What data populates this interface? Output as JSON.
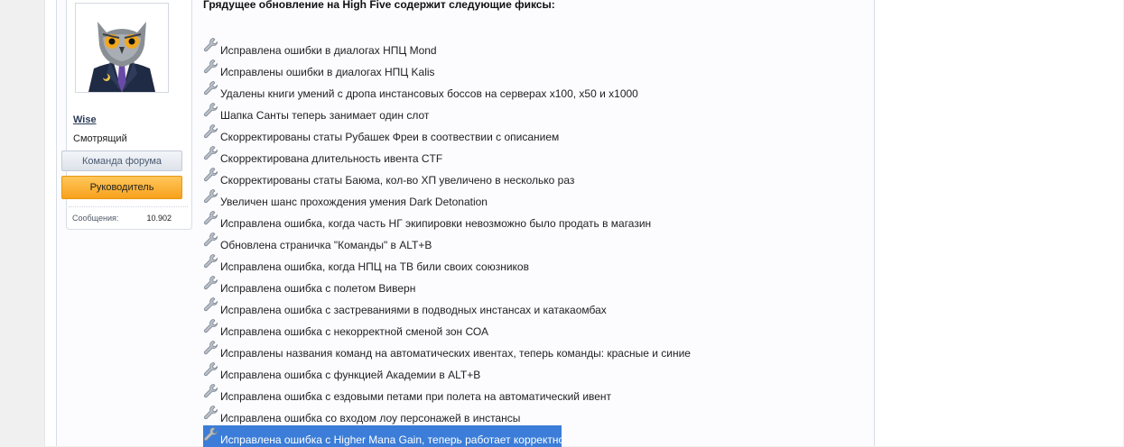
{
  "user": {
    "name": "Wise",
    "title": "Смотрящий",
    "badge_team": "Команда форума",
    "badge_role": "Руководитель",
    "messages_label": "Сообщения:",
    "messages_count": "10.902"
  },
  "post": {
    "heading": "Грядущее обновление на High Five содержит следующие фиксы:",
    "fixes": [
      "Исправлена ошибки в диалогах НПЦ Mond",
      "Исправлены ошибки в диалогах НПЦ Kalis",
      "Удалены книги умений с дропа инстансовых боссов на серверах x100, x50 и x1000",
      "Шапка Санты теперь занимает один слот",
      "Скорректированы статы Рубашек Фреи в соотвествии с описанием",
      "Скорректирована длительность ивента CTF",
      "Скорректированы статы Баюма, кол-во ХП увеличено в несколько раз",
      "Увеличен шанс прохождения умения Dark Detonation",
      "Исправлена ошибка, когда часть НГ экипировки невозможно было продать в магазин",
      "Обновлена страничка \"Команды\" в ALT+B",
      "Исправлена ошибка, когда НПЦ на ТВ били своих союзников",
      "Исправлена ошибка с полетом Виверн",
      "Исправлена ошибка с застреваниями в подводных инстансах и катакаомбах",
      "Исправлена ошибка с некорректной сменой зон СОА",
      "Исправлены названия команд на автоматических ивентах, теперь команды: красные и синие",
      "Исправлена ошибка с функцией Академии в ALT+B",
      "Исправлена ошибка с ездовыми петами при полета на автоматический ивент",
      "Исправлена ошибка со входом лоу персонажей в инстансы",
      "Исправлена ошибка с Higher Mana Gain, теперь работает корректно"
    ],
    "selected_index": 18
  },
  "icons": {
    "list_bullet": "wrench-icon",
    "avatar": "owl-in-suit-avatar"
  },
  "colors": {
    "selection": "#3b7dd8",
    "badge_role": "#f7a11c",
    "username": "#2a3b57"
  }
}
